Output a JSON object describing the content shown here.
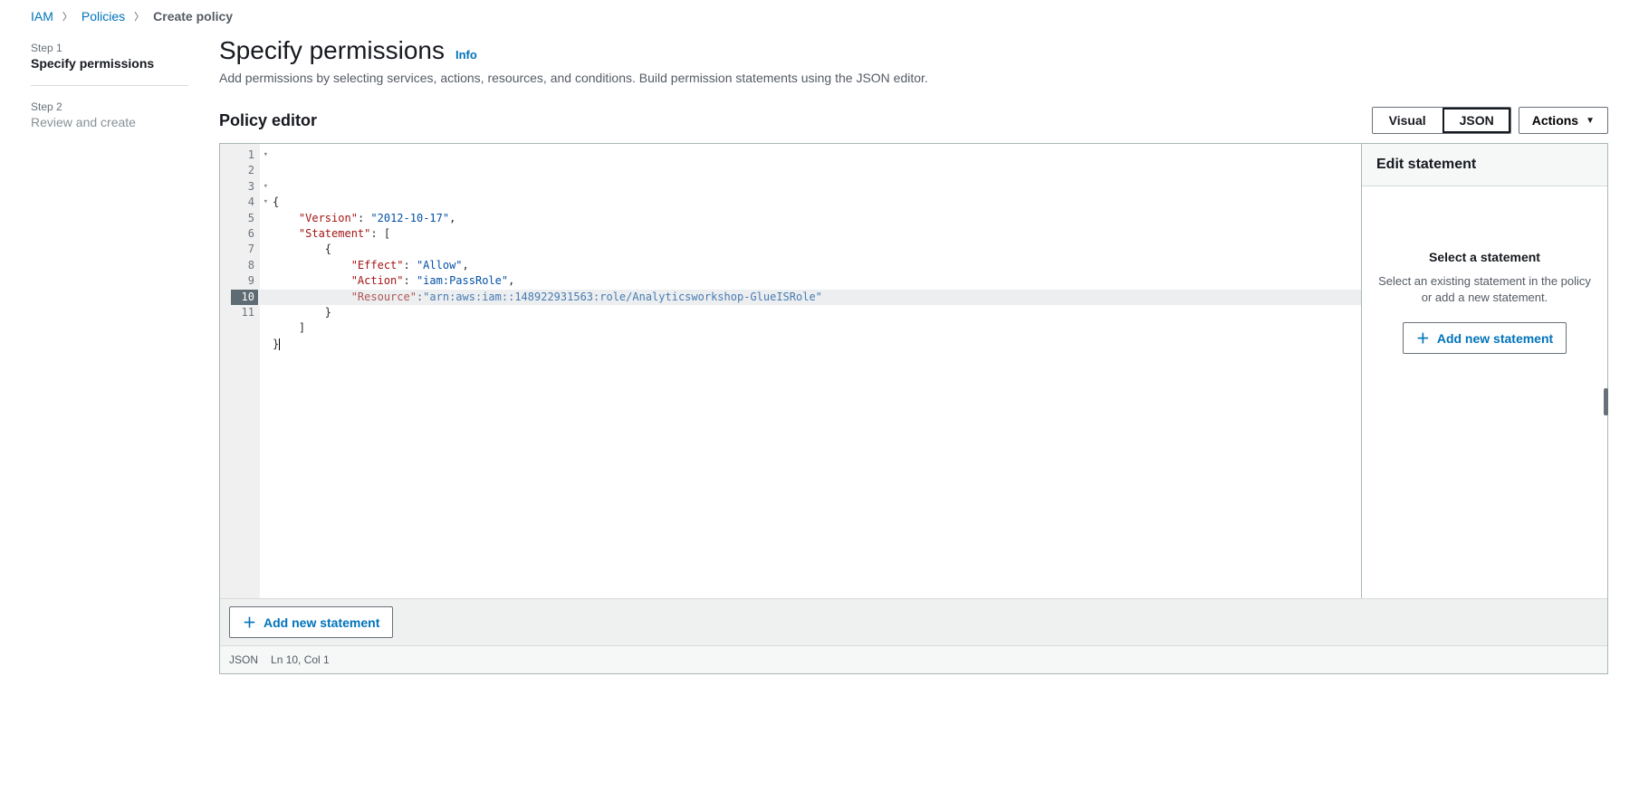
{
  "breadcrumb": {
    "items": [
      "IAM",
      "Policies"
    ],
    "current": "Create policy"
  },
  "sidebar": {
    "steps": [
      {
        "label": "Step 1",
        "name": "Specify permissions",
        "active": true
      },
      {
        "label": "Step 2",
        "name": "Review and create",
        "active": false
      }
    ]
  },
  "header": {
    "title": "Specify permissions",
    "info": "Info",
    "subtitle": "Add permissions by selecting services, actions, resources, and conditions. Build permission statements using the JSON editor."
  },
  "editor": {
    "title": "Policy editor",
    "tabs": {
      "visual": "Visual",
      "json": "JSON"
    },
    "actions_label": "Actions",
    "json_lines": [
      {
        "n": 1,
        "fold": true,
        "segs": [
          [
            "punc",
            "{"
          ]
        ]
      },
      {
        "n": 2,
        "fold": false,
        "segs": [
          [
            "pad",
            "    "
          ],
          [
            "key",
            "\"Version\""
          ],
          [
            "punc",
            ": "
          ],
          [
            "str",
            "\"2012-10-17\""
          ],
          [
            "punc",
            ","
          ]
        ]
      },
      {
        "n": 3,
        "fold": true,
        "segs": [
          [
            "pad",
            "    "
          ],
          [
            "key",
            "\"Statement\""
          ],
          [
            "punc",
            ": ["
          ]
        ]
      },
      {
        "n": 4,
        "fold": true,
        "segs": [
          [
            "pad",
            "        "
          ],
          [
            "punc",
            "{"
          ]
        ]
      },
      {
        "n": 5,
        "fold": false,
        "segs": [
          [
            "pad",
            "            "
          ],
          [
            "key",
            "\"Effect\""
          ],
          [
            "punc",
            ": "
          ],
          [
            "str",
            "\"Allow\""
          ],
          [
            "punc",
            ","
          ]
        ]
      },
      {
        "n": 6,
        "fold": false,
        "segs": [
          [
            "pad",
            "            "
          ],
          [
            "key",
            "\"Action\""
          ],
          [
            "punc",
            ": "
          ],
          [
            "str",
            "\"iam:PassRole\""
          ],
          [
            "punc",
            ","
          ]
        ]
      },
      {
        "n": 7,
        "fold": false,
        "segs": [
          [
            "pad",
            "            "
          ],
          [
            "key",
            "\"Resource\""
          ],
          [
            "punc",
            ":"
          ],
          [
            "str",
            "\"arn:aws:iam::148922931563:role/Analyticsworkshop-GlueISRole\""
          ]
        ]
      },
      {
        "n": 8,
        "fold": false,
        "segs": [
          [
            "pad",
            "        "
          ],
          [
            "punc",
            "}"
          ]
        ]
      },
      {
        "n": 9,
        "fold": false,
        "segs": [
          [
            "pad",
            "    "
          ],
          [
            "punc",
            "]"
          ]
        ]
      },
      {
        "n": 10,
        "fold": false,
        "active": true,
        "cursor": true,
        "segs": [
          [
            "punc",
            "}"
          ]
        ]
      },
      {
        "n": 11,
        "fold": false,
        "segs": []
      }
    ],
    "add_statement": "Add new statement",
    "status": {
      "mode": "JSON",
      "pos": "Ln 10, Col 1"
    }
  },
  "right_panel": {
    "title": "Edit statement",
    "heading": "Select a statement",
    "desc": "Select an existing statement in the policy or add a new statement.",
    "add": "Add new statement"
  }
}
